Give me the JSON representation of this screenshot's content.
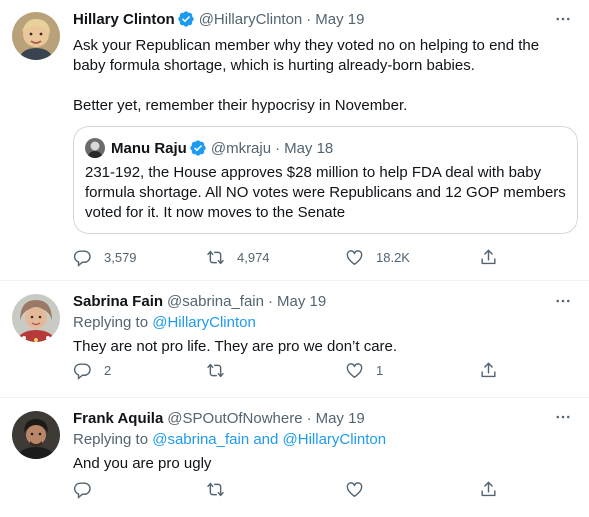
{
  "icons": {
    "verified": "verified-badge-icon",
    "more": "more-horizontal-icon",
    "reply": "reply-icon",
    "retweet": "retweet-icon",
    "like": "heart-icon",
    "share": "share-icon"
  },
  "colors": {
    "accent": "#1d9bf0",
    "text": "#0f1419",
    "secondary": "#536471",
    "border": "#cfd9de"
  },
  "tweets": [
    {
      "name": "Hillary Clinton",
      "verified": true,
      "handle": "@HillaryClinton",
      "dot": "·",
      "time": "May 19",
      "text": "Ask your Republican member why they voted no on helping to end the baby formula shortage, which is hurting already-born babies.\n\nBetter yet, remember their hypocrisy in November.",
      "quote": {
        "name": "Manu Raju",
        "verified": true,
        "handle": "@mkraju",
        "dot": "·",
        "time": "May 18",
        "text": "231-192, the House approves $28 million to help FDA deal with baby formula shortage. All NO votes were Republicans and 12 GOP members voted for it. It now moves to the Senate"
      },
      "actions": {
        "replies": "3,579",
        "retweets": "4,974",
        "likes": "18.2K"
      }
    },
    {
      "name": "Sabrina Fain",
      "handle": "@sabrina_fain",
      "dot": "·",
      "time": "May 19",
      "replying_prefix": "Replying to ",
      "replying_to": "@HillaryClinton",
      "text": "They are not pro life. They are pro we don’t care.",
      "actions": {
        "replies": "2",
        "retweets": "",
        "likes": "1"
      }
    },
    {
      "name": "Frank Aquila",
      "handle": "@SPOutOfNowhere",
      "dot": "·",
      "time": "May 19",
      "replying_prefix": "Replying to ",
      "replying_to": "@sabrina_fain and @HillaryClinton",
      "text": "And you are pro ugly",
      "actions": {
        "replies": "",
        "retweets": "",
        "likes": ""
      }
    }
  ]
}
